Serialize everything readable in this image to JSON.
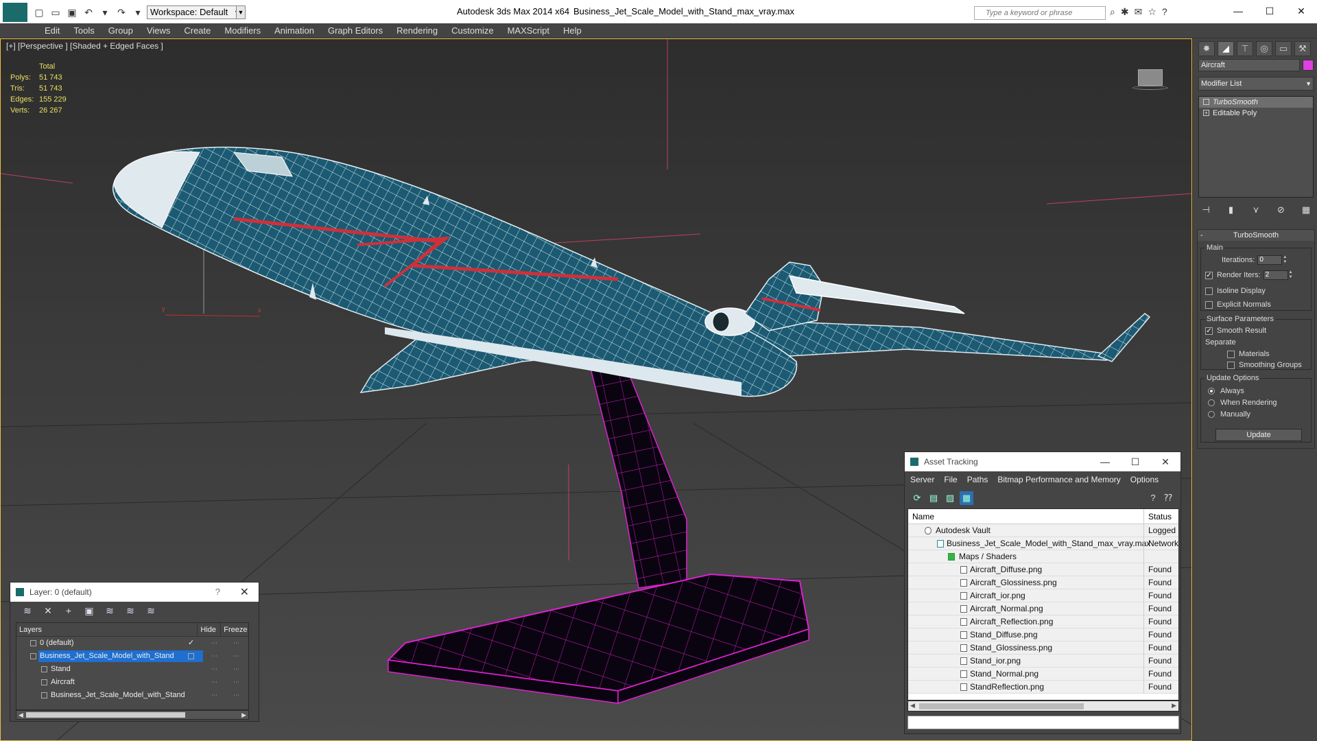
{
  "titlebar": {
    "workspace": "Workspace: Default",
    "app_title": "Autodesk 3ds Max  2014 x64",
    "file_title": "Business_Jet_Scale_Model_with_Stand_max_vray.max",
    "search_placeholder": "Type a keyword or phrase"
  },
  "menu": [
    "Edit",
    "Tools",
    "Group",
    "Views",
    "Create",
    "Modifiers",
    "Animation",
    "Graph Editors",
    "Rendering",
    "Customize",
    "MAXScript",
    "Help"
  ],
  "viewport": {
    "label": "[+] [Perspective ] [Shaded + Edged Faces ]",
    "stats": {
      "total_label": "Total",
      "rows": [
        {
          "key": "Polys:",
          "value": "51 743"
        },
        {
          "key": "Tris:",
          "value": "51 743"
        },
        {
          "key": "Edges:",
          "value": "155 229"
        },
        {
          "key": "Verts:",
          "value": "26 267"
        }
      ]
    },
    "gizmo_z": "z",
    "gizmo_y": "y",
    "gizmo_x": "x",
    "colors": {
      "aircraft_body": "#1b5a72",
      "wire": "#e0eef2",
      "stripe": "#d0303a",
      "stand": "#0a0410",
      "stand_wire": "#e020d0"
    }
  },
  "command_panel": {
    "object_name": "Aircraft",
    "object_color": "#e040e0",
    "modifier_list": "Modifier List",
    "stack": [
      {
        "label": "TurboSmooth",
        "selected": true
      },
      {
        "label": "Editable Poly",
        "selected": false
      }
    ],
    "turbosmooth": {
      "title": "TurboSmooth",
      "main_title": "Main",
      "iterations_label": "Iterations:",
      "iterations_value": "0",
      "render_iters_label": "Render Iters:",
      "render_iters_value": "2",
      "isoline_label": "Isoline Display",
      "explicit_label": "Explicit Normals",
      "surface_title": "Surface Parameters",
      "smooth_result_label": "Smooth Result",
      "separate_label": "Separate",
      "materials_label": "Materials",
      "smoothing_groups_label": "Smoothing Groups",
      "update_title": "Update Options",
      "always_label": "Always",
      "when_rendering_label": "When Rendering",
      "manually_label": "Manually",
      "update_button": "Update"
    }
  },
  "layer_window": {
    "title": "Layer: 0 (default)",
    "help": "?",
    "columns": {
      "layers": "Layers",
      "hide": "Hide",
      "freeze": "Freeze"
    },
    "rows": [
      {
        "name": "0 (default)",
        "indent": 0,
        "selected": false
      },
      {
        "name": "Business_Jet_Scale_Model_with_Stand",
        "indent": 0,
        "selected": true
      },
      {
        "name": "Stand",
        "indent": 1,
        "selected": false
      },
      {
        "name": "Aircraft",
        "indent": 1,
        "selected": false
      },
      {
        "name": "Business_Jet_Scale_Model_with_Stand",
        "indent": 1,
        "selected": false
      }
    ]
  },
  "asset_window": {
    "title": "Asset Tracking",
    "menu": [
      "Server",
      "File",
      "Paths",
      "Bitmap Performance and Memory",
      "Options"
    ],
    "columns": {
      "name": "Name",
      "status": "Status"
    },
    "rows": [
      {
        "name": "Autodesk Vault",
        "status": "Logged O",
        "indent": 0
      },
      {
        "name": "Business_Jet_Scale_Model_with_Stand_max_vray.max",
        "status": "Network",
        "indent": 1
      },
      {
        "name": "Maps / Shaders",
        "status": "",
        "indent": 2
      },
      {
        "name": "Aircraft_Diffuse.png",
        "status": "Found",
        "indent": 3
      },
      {
        "name": "Aircraft_Glossiness.png",
        "status": "Found",
        "indent": 3
      },
      {
        "name": "Aircraft_ior.png",
        "status": "Found",
        "indent": 3
      },
      {
        "name": "Aircraft_Normal.png",
        "status": "Found",
        "indent": 3
      },
      {
        "name": "Aircraft_Reflection.png",
        "status": "Found",
        "indent": 3
      },
      {
        "name": "Stand_Diffuse.png",
        "status": "Found",
        "indent": 3
      },
      {
        "name": "Stand_Glossiness.png",
        "status": "Found",
        "indent": 3
      },
      {
        "name": "Stand_ior.png",
        "status": "Found",
        "indent": 3
      },
      {
        "name": "Stand_Normal.png",
        "status": "Found",
        "indent": 3
      },
      {
        "name": "StandReflection.png",
        "status": "Found",
        "indent": 3
      }
    ]
  }
}
